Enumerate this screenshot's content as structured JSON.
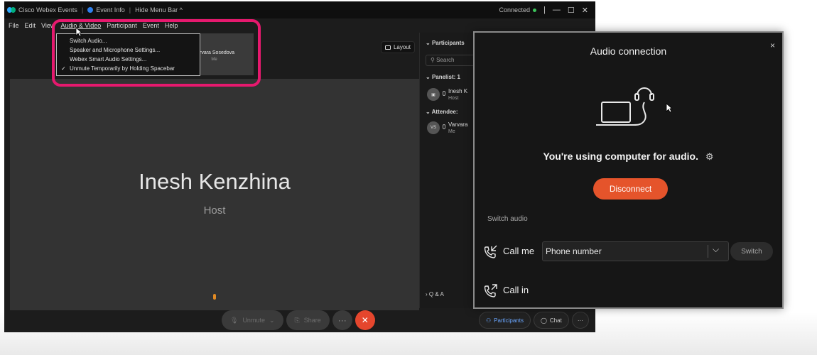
{
  "titlebar": {
    "app_name": "Cisco Webex Events",
    "event_info": "Event Info",
    "hide_menu": "Hide Menu Bar ^",
    "status": "Connected",
    "sep": "|",
    "minimize": "—",
    "maximize": "☐",
    "close": "✕"
  },
  "menubar": {
    "items": [
      "File",
      "Edit",
      "View",
      "Audio & Video",
      "Participant",
      "Event",
      "Help"
    ]
  },
  "audio_menu": {
    "items": [
      "Switch Audio...",
      "Speaker and Microphone Settings...",
      "Webex Smart Audio Settings...",
      "Unmute Temporarily by Holding Spacebar"
    ],
    "checked_mark": "✓"
  },
  "thumbnail": {
    "name": "Varvara Sosedova",
    "sub": "Me"
  },
  "layout_button": "Layout",
  "stage": {
    "speaker_name": "Inesh Kenzhina",
    "speaker_role": "Host"
  },
  "controls": {
    "unmute": "Unmute",
    "share": "Share",
    "more": "···",
    "end": "✕"
  },
  "bottom_right": {
    "participants": "Participants",
    "chat": "Chat",
    "more": "···"
  },
  "participants_panel": {
    "header": "Participants",
    "search_placeholder": "Search",
    "panelist_section": "Panelist: 1",
    "panelist_name": "Inesh K",
    "panelist_role": "Host",
    "attendee_section": "Attendee:",
    "attendee_initials": "VS",
    "attendee_name": "Varvara",
    "attendee_role": "Me",
    "qa_label": "Q & A"
  },
  "audio_dialog": {
    "title": "Audio connection",
    "close": "×",
    "status_text": "You're using computer for audio.",
    "disconnect_label": "Disconnect",
    "switch_audio_label": "Switch audio",
    "call_me_label": "Call me",
    "phone_placeholder": "Phone number",
    "switch_label": "Switch",
    "call_in_label": "Call in"
  },
  "colors": {
    "accent_highlight": "#e6196e",
    "disconnect": "#e5542b",
    "end_call": "#e5462d",
    "connected": "#3cc35a"
  },
  "icons": [
    "webex-logo-icon",
    "info-icon",
    "layout-icon",
    "search-icon",
    "headset-laptop-icon",
    "gear-icon",
    "call-me-icon",
    "call-in-icon",
    "chevron-down-icon",
    "mic-icon",
    "share-icon",
    "people-icon",
    "chat-icon"
  ]
}
